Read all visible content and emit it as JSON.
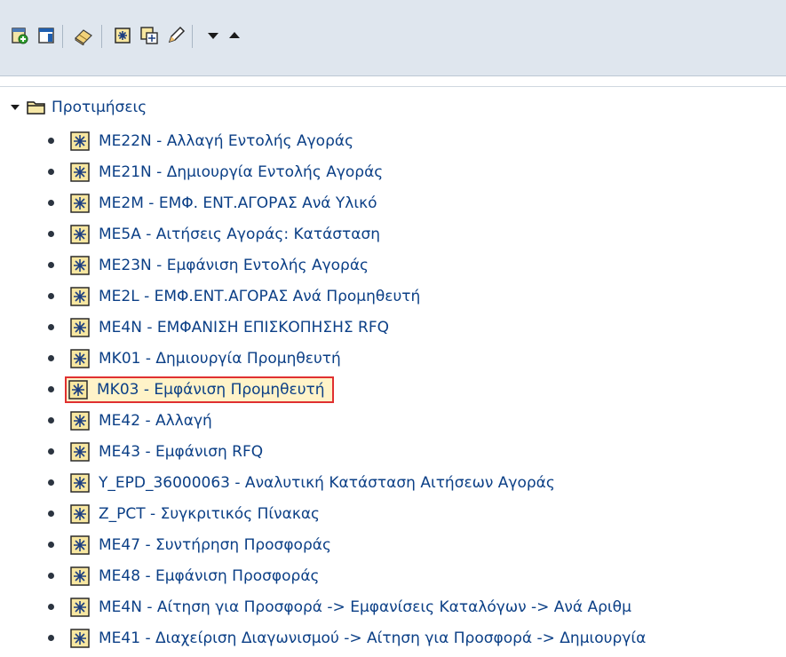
{
  "toolbar": {
    "buttons": [
      {
        "name": "add-favorite-icon"
      },
      {
        "name": "change-favorite-icon"
      },
      {
        "name": "delete-favorite-icon"
      },
      {
        "name": "move-favorite-icon"
      },
      {
        "name": "copy-favorite-icon"
      },
      {
        "name": "edit-icon"
      },
      {
        "name": "move-down-icon"
      },
      {
        "name": "move-up-icon"
      }
    ]
  },
  "tree": {
    "root": {
      "label": "Προτιμήσεις",
      "expanded": true
    },
    "items": [
      {
        "label": "ME22N - Αλλαγή Εντολής Αγοράς"
      },
      {
        "label": "ME21N - Δημιουργία Εντολής Αγοράς"
      },
      {
        "label": "ME2M - ΕΜΦ. ΕΝΤ.ΑΓΟΡΑΣ Ανά Υλικό"
      },
      {
        "label": "ME5A - Αιτήσεις Αγοράς: Κατάσταση"
      },
      {
        "label": "ME23N - Εμφάνιση Εντολής Αγοράς"
      },
      {
        "label": "ME2L - ΕΜΦ.ΕΝΤ.ΑΓΟΡΑΣ Ανά Προμηθευτή"
      },
      {
        "label": "ME4N - ΕΜΦΑΝΙΣΗ ΕΠΙΣΚΟΠΗΣΗΣ RFQ"
      },
      {
        "label": "MK01 - Δημιουργία Προμηθευτή"
      },
      {
        "label": "MK03 - Εμφάνιση Προμηθευτή",
        "selected": true
      },
      {
        "label": "ME42 - Αλλαγή"
      },
      {
        "label": "ME43 - Εμφάνιση RFQ"
      },
      {
        "label": "Y_EPD_36000063 - Αναλυτική Κατάσταση Αιτήσεων Αγοράς"
      },
      {
        "label": "Z_PCT - Συγκριτικός Πίνακας"
      },
      {
        "label": "ME47 - Συντήρηση Προσφοράς"
      },
      {
        "label": "ME48 - Εμφάνιση Προσφοράς"
      },
      {
        "label": "ME4N - Αίτηση για Προσφορά -> Εμφανίσεις Καταλόγων -> Ανά Αριθμ"
      },
      {
        "label": "ME41 - Διαχείριση Διαγωνισμού -> Αίτηση για Προσφορά -> Δημιουργία"
      }
    ]
  },
  "colors": {
    "toolbar_bg": "#dfe6ee",
    "link_text": "#0b3f86",
    "selection_border": "#e03030",
    "selection_bg": "#fff3c8"
  }
}
